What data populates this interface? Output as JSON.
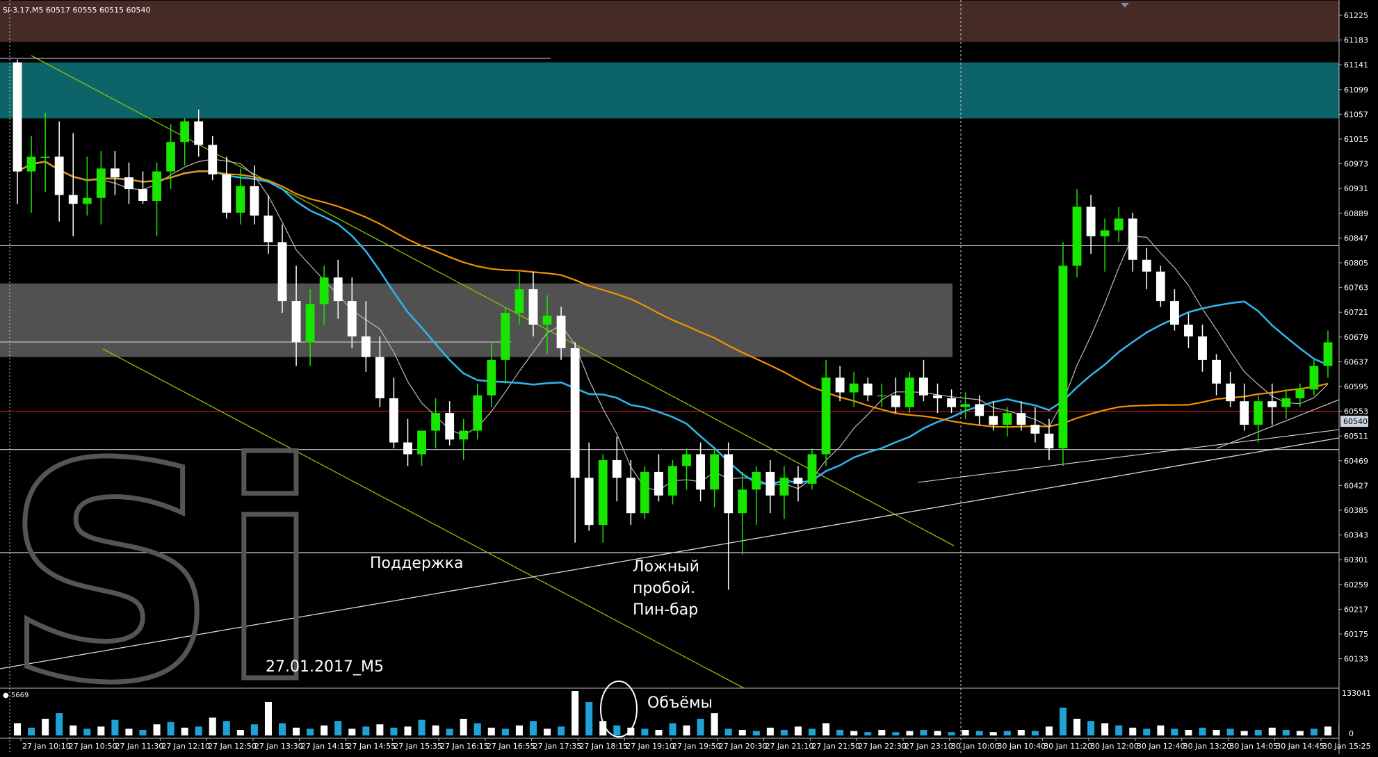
{
  "header": {
    "symbol_timeframe": "Si-3.17,M5",
    "ohlc": "60517 60555 60515 60540"
  },
  "annotations": {
    "support": "Поддержка",
    "false_breakout": [
      "Ложный",
      "пробой.",
      "Пин-бар"
    ],
    "volumes": "Объёмы",
    "date_label": "27.01.2017_M5",
    "watermark": "Si"
  },
  "volume_panel": {
    "label": "5669",
    "ticks": [
      "133041",
      "0"
    ]
  },
  "chart_data": {
    "type": "candlestick",
    "title": "Si-3.17,M5",
    "y_ticks": [
      61225,
      61183,
      61141,
      61099,
      61057,
      61015,
      60973,
      60931,
      60889,
      60847,
      60805,
      60763,
      60721,
      60679,
      60637,
      60595,
      60553,
      60511,
      60469,
      60427,
      60385,
      60343,
      60301,
      60259,
      60217,
      60175,
      60133
    ],
    "ylim": [
      60100,
      61250
    ],
    "current_price": 60540,
    "x_ticks": [
      "27 Jan 10:10",
      "27 Jan 10:50",
      "27 Jan 11:30",
      "27 Jan 12:10",
      "27 Jan 12:50",
      "27 Jan 13:30",
      "27 Jan 14:15",
      "27 Jan 14:55",
      "27 Jan 15:35",
      "27 Jan 16:15",
      "27 Jan 16:55",
      "27 Jan 17:35",
      "27 Jan 18:15",
      "27 Jan 19:10",
      "27 Jan 19:50",
      "27 Jan 20:30",
      "27 Jan 21:10",
      "27 Jan 21:50",
      "27 Jan 22:30",
      "27 Jan 23:10",
      "30 Jan 10:00",
      "30 Jan 10:40",
      "30 Jan 11:20",
      "30 Jan 12:00",
      "30 Jan 12:40",
      "30 Jan 13:20",
      "30 Jan 14:05",
      "30 Jan 14:45",
      "30 Jan 15:25"
    ],
    "zones": [
      {
        "name": "resistance",
        "from": 61180,
        "to": 61250,
        "color": "#452a26"
      },
      {
        "name": "resistance-2",
        "from": 61050,
        "to": 61145,
        "color": "#0d6468"
      },
      {
        "name": "range",
        "from": 60645,
        "to": 60770,
        "color": "#515151"
      }
    ],
    "horizontal_levels": [
      {
        "price": 60834,
        "color": "#cfcfcf"
      },
      {
        "price": 60553,
        "color": "#c41414"
      },
      {
        "price": 60488,
        "color": "#cfcfcf"
      },
      {
        "price": 60313,
        "color": "#cfcfcf"
      }
    ],
    "session_break_price_start": "30 Jan 10:00",
    "candles": [
      [
        61145,
        61150,
        60905,
        60960
      ],
      [
        60960,
        61020,
        60890,
        60985
      ],
      [
        60985,
        61060,
        60925,
        60985
      ],
      [
        60985,
        61045,
        60875,
        60920
      ],
      [
        60920,
        61025,
        60850,
        60905
      ],
      [
        60905,
        60985,
        60885,
        60915
      ],
      [
        60915,
        60995,
        60870,
        60965
      ],
      [
        60965,
        60995,
        60920,
        60950
      ],
      [
        60950,
        60975,
        60905,
        60930
      ],
      [
        60930,
        60960,
        60905,
        60910
      ],
      [
        60910,
        60975,
        60850,
        60960
      ],
      [
        60960,
        61040,
        60930,
        61010
      ],
      [
        61010,
        61050,
        60970,
        61045
      ],
      [
        61045,
        61065,
        60985,
        61005
      ],
      [
        61005,
        61020,
        60945,
        60955
      ],
      [
        60955,
        60985,
        60880,
        60890
      ],
      [
        60890,
        60965,
        60870,
        60935
      ],
      [
        60935,
        60970,
        60870,
        60885
      ],
      [
        60885,
        60920,
        60820,
        60840
      ],
      [
        60840,
        60870,
        60720,
        60740
      ],
      [
        60740,
        60800,
        60630,
        60670
      ],
      [
        60670,
        60760,
        60630,
        60735
      ],
      [
        60735,
        60800,
        60700,
        60780
      ],
      [
        60780,
        60810,
        60710,
        60740
      ],
      [
        60740,
        60780,
        60660,
        60680
      ],
      [
        60680,
        60740,
        60620,
        60645
      ],
      [
        60645,
        60680,
        60560,
        60575
      ],
      [
        60575,
        60610,
        60490,
        60500
      ],
      [
        60500,
        60540,
        60460,
        60480
      ],
      [
        60480,
        60520,
        60460,
        60520
      ],
      [
        60520,
        60575,
        60490,
        60550
      ],
      [
        60550,
        60570,
        60495,
        60505
      ],
      [
        60505,
        60540,
        60470,
        60520
      ],
      [
        60520,
        60600,
        60505,
        60580
      ],
      [
        60580,
        60670,
        60560,
        60640
      ],
      [
        60640,
        60730,
        60600,
        60720
      ],
      [
        60720,
        60790,
        60700,
        60760
      ],
      [
        60760,
        60790,
        60680,
        60700
      ],
      [
        60700,
        60750,
        60650,
        60715
      ],
      [
        60715,
        60730,
        60640,
        60660
      ],
      [
        60660,
        60670,
        60330,
        60440
      ],
      [
        60440,
        60500,
        60350,
        60360
      ],
      [
        60360,
        60480,
        60330,
        60470
      ],
      [
        60470,
        60510,
        60400,
        60440
      ],
      [
        60440,
        60470,
        60360,
        60380
      ],
      [
        60380,
        60460,
        60370,
        60450
      ],
      [
        60450,
        60480,
        60400,
        60410
      ],
      [
        60410,
        60470,
        60395,
        60460
      ],
      [
        60460,
        60490,
        60420,
        60480
      ],
      [
        60480,
        60500,
        60400,
        60420
      ],
      [
        60420,
        60490,
        60390,
        60480
      ],
      [
        60480,
        60500,
        60250,
        60380
      ],
      [
        60380,
        60450,
        60310,
        60420
      ],
      [
        60420,
        60460,
        60360,
        60450
      ],
      [
        60450,
        60470,
        60380,
        60410
      ],
      [
        60410,
        60460,
        60370,
        60440
      ],
      [
        60440,
        60460,
        60400,
        60430
      ],
      [
        60430,
        60490,
        60420,
        60480
      ],
      [
        60480,
        60640,
        60460,
        60610
      ],
      [
        60610,
        60630,
        60570,
        60585
      ],
      [
        60585,
        60620,
        60560,
        60600
      ],
      [
        60600,
        60610,
        60570,
        60580
      ],
      [
        60580,
        60600,
        60560,
        60580
      ],
      [
        60580,
        60610,
        60550,
        60560
      ],
      [
        60560,
        60620,
        60550,
        60610
      ],
      [
        60610,
        60640,
        60570,
        60580
      ],
      [
        60580,
        60600,
        60550,
        60575
      ],
      [
        60575,
        60590,
        60550,
        60560
      ],
      [
        60560,
        60585,
        60540,
        60565
      ],
      [
        60565,
        60580,
        60530,
        60545
      ],
      [
        60545,
        60570,
        60520,
        60530
      ],
      [
        60530,
        60560,
        60510,
        60550
      ],
      [
        60550,
        60570,
        60520,
        60530
      ],
      [
        60530,
        60560,
        60500,
        60515
      ],
      [
        60515,
        60540,
        60470,
        60490
      ],
      [
        60490,
        60840,
        60460,
        60800
      ],
      [
        60800,
        60930,
        60780,
        60900
      ],
      [
        60900,
        60920,
        60820,
        60850
      ],
      [
        60850,
        60880,
        60790,
        60860
      ],
      [
        60860,
        60900,
        60840,
        60880
      ],
      [
        60880,
        60890,
        60790,
        60810
      ],
      [
        60810,
        60830,
        60760,
        60790
      ],
      [
        60790,
        60800,
        60730,
        60740
      ],
      [
        60740,
        60760,
        60690,
        60700
      ],
      [
        60700,
        60720,
        60660,
        60680
      ],
      [
        60680,
        60700,
        60620,
        60640
      ],
      [
        60640,
        60650,
        60580,
        60600
      ],
      [
        60600,
        60620,
        60560,
        60570
      ],
      [
        60570,
        60600,
        60520,
        60530
      ],
      [
        60530,
        60580,
        60500,
        60570
      ],
      [
        60570,
        60600,
        60530,
        60560
      ],
      [
        60560,
        60590,
        60540,
        60575
      ],
      [
        60575,
        60600,
        60560,
        60590
      ],
      [
        60590,
        60640,
        60580,
        60630
      ],
      [
        60630,
        60690,
        60610,
        60670
      ]
    ],
    "volumes": [
      22,
      14,
      30,
      40,
      18,
      12,
      16,
      28,
      12,
      10,
      20,
      24,
      14,
      16,
      32,
      26,
      10,
      20,
      60,
      22,
      14,
      12,
      18,
      26,
      12,
      16,
      20,
      14,
      16,
      28,
      18,
      12,
      30,
      22,
      14,
      12,
      18,
      26,
      12,
      16,
      80,
      60,
      26,
      18,
      14,
      12,
      10,
      22,
      18,
      30,
      40,
      12,
      10,
      8,
      14,
      10,
      16,
      12,
      22,
      10,
      8,
      6,
      10,
      6,
      8,
      10,
      8,
      6,
      10,
      8,
      6,
      8,
      10,
      8,
      16,
      50,
      30,
      26,
      22,
      18,
      14,
      12,
      18,
      12,
      10,
      14,
      10,
      12,
      8,
      10,
      14,
      10,
      8,
      12,
      16,
      22
    ]
  }
}
